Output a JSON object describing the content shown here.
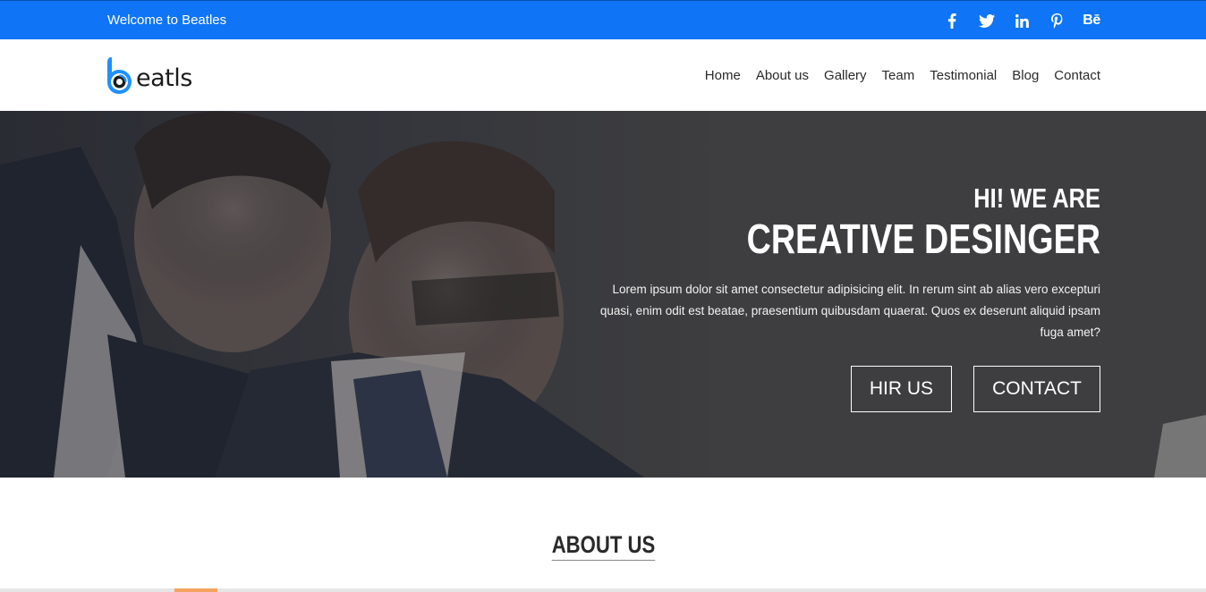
{
  "topbar": {
    "welcome": "Welcome to Beatles",
    "social": [
      {
        "icon": "facebook-icon"
      },
      {
        "icon": "twitter-icon"
      },
      {
        "icon": "linkedin-icon"
      },
      {
        "icon": "pinterest-icon"
      },
      {
        "icon": "behance-icon",
        "label": "Bē"
      }
    ],
    "bg_color": "#0f74f5"
  },
  "logo": {
    "text": "eatls",
    "mark_color": "#1e90ff"
  },
  "menu": {
    "items": [
      "Home",
      "About us",
      "Gallery",
      "Team",
      "Testimonial",
      "Blog",
      "Contact"
    ]
  },
  "hero": {
    "subtitle": "HI! WE ARE",
    "title": "CREATIVE DESINGER",
    "description": "Lorem ipsum dolor sit amet consectetur adipisicing elit. In rerum sint ab alias vero excepturi quasi, enim odit est beatae, praesentium quibusdam quaerat. Quos ex deserunt aliquid ipsam fuga amet?",
    "buttons": {
      "hire": "HIR US",
      "contact": "CONTACT"
    }
  },
  "about": {
    "title": "ABOUT US",
    "accent_color": "#f4a460"
  }
}
